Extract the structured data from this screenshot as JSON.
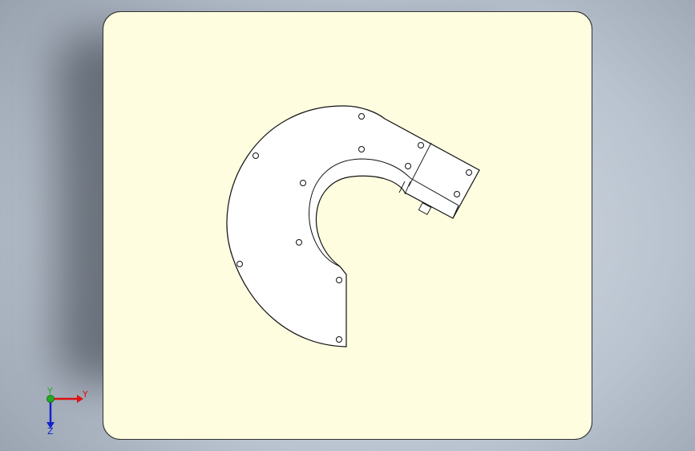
{
  "colors": {
    "sheet_fill": "#fefde0",
    "part_fill": "#ffffff",
    "edge_color": "#111111",
    "axis_x_color": "#dd1111",
    "axis_y_color": "#22aa22",
    "axis_z_color": "#1122cc"
  },
  "triad": {
    "x_label": "Y",
    "y_label": "Y",
    "z_label": "Z"
  },
  "icons": {
    "triad": "coordinate-triad-icon"
  }
}
